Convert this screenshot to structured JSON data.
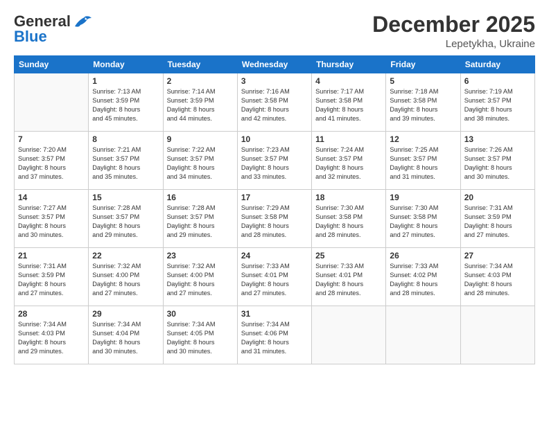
{
  "header": {
    "logo_general": "General",
    "logo_blue": "Blue",
    "month": "December 2025",
    "location": "Lepetykha, Ukraine"
  },
  "weekdays": [
    "Sunday",
    "Monday",
    "Tuesday",
    "Wednesday",
    "Thursday",
    "Friday",
    "Saturday"
  ],
  "weeks": [
    [
      {
        "day": "",
        "text": ""
      },
      {
        "day": "1",
        "text": "Sunrise: 7:13 AM\nSunset: 3:59 PM\nDaylight: 8 hours\nand 45 minutes."
      },
      {
        "day": "2",
        "text": "Sunrise: 7:14 AM\nSunset: 3:59 PM\nDaylight: 8 hours\nand 44 minutes."
      },
      {
        "day": "3",
        "text": "Sunrise: 7:16 AM\nSunset: 3:58 PM\nDaylight: 8 hours\nand 42 minutes."
      },
      {
        "day": "4",
        "text": "Sunrise: 7:17 AM\nSunset: 3:58 PM\nDaylight: 8 hours\nand 41 minutes."
      },
      {
        "day": "5",
        "text": "Sunrise: 7:18 AM\nSunset: 3:58 PM\nDaylight: 8 hours\nand 39 minutes."
      },
      {
        "day": "6",
        "text": "Sunrise: 7:19 AM\nSunset: 3:57 PM\nDaylight: 8 hours\nand 38 minutes."
      }
    ],
    [
      {
        "day": "7",
        "text": "Sunrise: 7:20 AM\nSunset: 3:57 PM\nDaylight: 8 hours\nand 37 minutes."
      },
      {
        "day": "8",
        "text": "Sunrise: 7:21 AM\nSunset: 3:57 PM\nDaylight: 8 hours\nand 35 minutes."
      },
      {
        "day": "9",
        "text": "Sunrise: 7:22 AM\nSunset: 3:57 PM\nDaylight: 8 hours\nand 34 minutes."
      },
      {
        "day": "10",
        "text": "Sunrise: 7:23 AM\nSunset: 3:57 PM\nDaylight: 8 hours\nand 33 minutes."
      },
      {
        "day": "11",
        "text": "Sunrise: 7:24 AM\nSunset: 3:57 PM\nDaylight: 8 hours\nand 32 minutes."
      },
      {
        "day": "12",
        "text": "Sunrise: 7:25 AM\nSunset: 3:57 PM\nDaylight: 8 hours\nand 31 minutes."
      },
      {
        "day": "13",
        "text": "Sunrise: 7:26 AM\nSunset: 3:57 PM\nDaylight: 8 hours\nand 30 minutes."
      }
    ],
    [
      {
        "day": "14",
        "text": "Sunrise: 7:27 AM\nSunset: 3:57 PM\nDaylight: 8 hours\nand 30 minutes."
      },
      {
        "day": "15",
        "text": "Sunrise: 7:28 AM\nSunset: 3:57 PM\nDaylight: 8 hours\nand 29 minutes."
      },
      {
        "day": "16",
        "text": "Sunrise: 7:28 AM\nSunset: 3:57 PM\nDaylight: 8 hours\nand 29 minutes."
      },
      {
        "day": "17",
        "text": "Sunrise: 7:29 AM\nSunset: 3:58 PM\nDaylight: 8 hours\nand 28 minutes."
      },
      {
        "day": "18",
        "text": "Sunrise: 7:30 AM\nSunset: 3:58 PM\nDaylight: 8 hours\nand 28 minutes."
      },
      {
        "day": "19",
        "text": "Sunrise: 7:30 AM\nSunset: 3:58 PM\nDaylight: 8 hours\nand 27 minutes."
      },
      {
        "day": "20",
        "text": "Sunrise: 7:31 AM\nSunset: 3:59 PM\nDaylight: 8 hours\nand 27 minutes."
      }
    ],
    [
      {
        "day": "21",
        "text": "Sunrise: 7:31 AM\nSunset: 3:59 PM\nDaylight: 8 hours\nand 27 minutes."
      },
      {
        "day": "22",
        "text": "Sunrise: 7:32 AM\nSunset: 4:00 PM\nDaylight: 8 hours\nand 27 minutes."
      },
      {
        "day": "23",
        "text": "Sunrise: 7:32 AM\nSunset: 4:00 PM\nDaylight: 8 hours\nand 27 minutes."
      },
      {
        "day": "24",
        "text": "Sunrise: 7:33 AM\nSunset: 4:01 PM\nDaylight: 8 hours\nand 27 minutes."
      },
      {
        "day": "25",
        "text": "Sunrise: 7:33 AM\nSunset: 4:01 PM\nDaylight: 8 hours\nand 28 minutes."
      },
      {
        "day": "26",
        "text": "Sunrise: 7:33 AM\nSunset: 4:02 PM\nDaylight: 8 hours\nand 28 minutes."
      },
      {
        "day": "27",
        "text": "Sunrise: 7:34 AM\nSunset: 4:03 PM\nDaylight: 8 hours\nand 28 minutes."
      }
    ],
    [
      {
        "day": "28",
        "text": "Sunrise: 7:34 AM\nSunset: 4:03 PM\nDaylight: 8 hours\nand 29 minutes."
      },
      {
        "day": "29",
        "text": "Sunrise: 7:34 AM\nSunset: 4:04 PM\nDaylight: 8 hours\nand 30 minutes."
      },
      {
        "day": "30",
        "text": "Sunrise: 7:34 AM\nSunset: 4:05 PM\nDaylight: 8 hours\nand 30 minutes."
      },
      {
        "day": "31",
        "text": "Sunrise: 7:34 AM\nSunset: 4:06 PM\nDaylight: 8 hours\nand 31 minutes."
      },
      {
        "day": "",
        "text": ""
      },
      {
        "day": "",
        "text": ""
      },
      {
        "day": "",
        "text": ""
      }
    ]
  ]
}
